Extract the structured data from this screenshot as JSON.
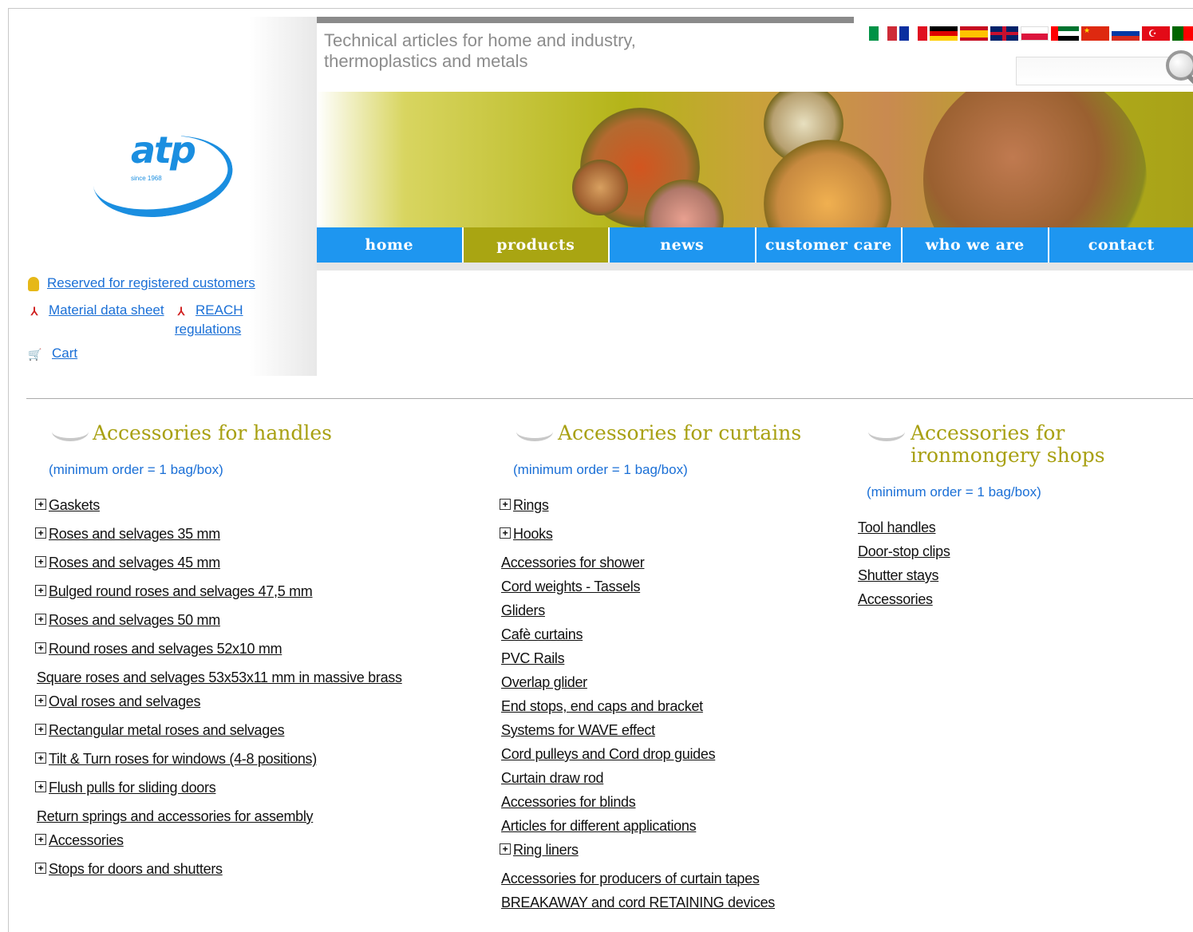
{
  "tagline": "Technical articles for home and industry, thermoplastics and metals",
  "logo": {
    "text": "atp",
    "since": "since 1968"
  },
  "flags": [
    "italy-flag",
    "france-flag",
    "germany-flag",
    "spain-flag",
    "uk-flag",
    "poland-flag",
    "uae-flag",
    "china-flag",
    "russia-flag",
    "turkey-flag",
    "portugal-flag"
  ],
  "nav": [
    "home",
    "products",
    "news",
    "customer care",
    "who we are",
    "contact"
  ],
  "nav_active": "products",
  "side_links": {
    "registered": "Reserved for registered customers",
    "material": "Material data sheet",
    "reach": "REACH regulations",
    "cart": "Cart"
  },
  "columns": [
    {
      "title": "Accessories for handles",
      "min_order": "(minimum order = 1 bag/box)",
      "items": [
        {
          "label": "Gaskets",
          "expand": true
        },
        {
          "label": "Roses and selvages 35 mm",
          "expand": true
        },
        {
          "label": "Roses and selvages 45 mm",
          "expand": true
        },
        {
          "label": "Bulged round roses and selvages 47,5 mm",
          "expand": true
        },
        {
          "label": "Roses and selvages 50 mm",
          "expand": true
        },
        {
          "label": "Round roses and selvages 52x10 mm",
          "expand": true
        },
        {
          "label": "Square roses and selvages 53x53x11 mm in massive brass",
          "expand": false
        },
        {
          "label": "Oval roses and selvages",
          "expand": true
        },
        {
          "label": "Rectangular metal roses and selvages",
          "expand": true
        },
        {
          "label": "Tilt & Turn roses for windows (4-8 positions)",
          "expand": true
        },
        {
          "label": "Flush pulls for sliding doors",
          "expand": true
        },
        {
          "label": "Return springs and accessories for assembly",
          "expand": false
        },
        {
          "label": "Accessories",
          "expand": true
        },
        {
          "label": "Stops for doors and shutters",
          "expand": true
        }
      ]
    },
    {
      "title": "Accessories for curtains",
      "min_order": "(minimum order = 1 bag/box)",
      "items": [
        {
          "label": "Rings",
          "expand": true
        },
        {
          "label": "Hooks",
          "expand": true
        },
        {
          "label": "Accessories for shower",
          "expand": false
        },
        {
          "label": "Cord weights - Tassels",
          "expand": false
        },
        {
          "label": "Gliders",
          "expand": false
        },
        {
          "label": "Cafè curtains",
          "expand": false
        },
        {
          "label": "PVC Rails",
          "expand": false
        },
        {
          "label": "Overlap glider",
          "expand": false
        },
        {
          "label": "End stops, end caps and bracket",
          "expand": false
        },
        {
          "label": "Systems for WAVE effect",
          "expand": false
        },
        {
          "label": "Cord pulleys and Cord drop guides",
          "expand": false
        },
        {
          "label": "Curtain draw rod",
          "expand": false
        },
        {
          "label": "Accessories for blinds",
          "expand": false
        },
        {
          "label": "Articles for different applications",
          "expand": false
        },
        {
          "label": "Ring liners",
          "expand": true
        },
        {
          "label": "Accessories for producers of curtain tapes",
          "expand": false
        },
        {
          "label": "BREAKAWAY and cord RETAINING devices",
          "expand": false
        }
      ]
    },
    {
      "title": "Accessories for ironmongery shops",
      "min_order": "(minimum order = 1 bag/box)",
      "items": [
        {
          "label": "Tool handles",
          "expand": false
        },
        {
          "label": "Door-stop clips",
          "expand": false
        },
        {
          "label": "Shutter stays",
          "expand": false
        },
        {
          "label": "Accessories",
          "expand": false
        }
      ]
    }
  ],
  "colors": {
    "nav_blue": "#1e96f0",
    "nav_active": "#a9a512",
    "heading": "#a8a012",
    "link": "#1a6fd6"
  }
}
